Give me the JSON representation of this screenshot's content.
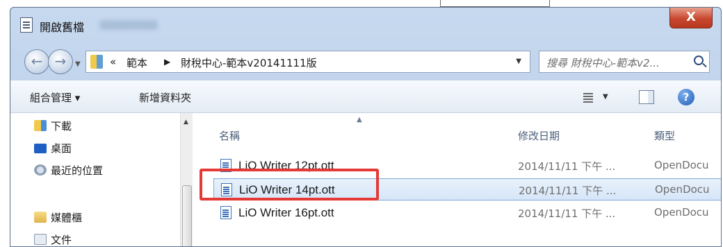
{
  "window": {
    "title": "開啟舊檔",
    "close_label": "X"
  },
  "address": {
    "prefix": "«",
    "crumbs": [
      "範本",
      "財稅中心-範本v20141111版"
    ],
    "separator": "▶",
    "search_placeholder": "搜尋 財稅中心-範本v2..."
  },
  "toolbar": {
    "organize_label": "組合管理 ▾",
    "new_folder_label": "新增資料夾",
    "help_label": "?"
  },
  "sidebar": {
    "items": [
      {
        "label": "下載",
        "icon": "download-folder-icon"
      },
      {
        "label": "桌面",
        "icon": "desktop-icon"
      },
      {
        "label": "最近的位置",
        "icon": "recent-places-icon"
      },
      {
        "label": "媒體櫃",
        "icon": "library-icon"
      },
      {
        "label": "文件",
        "icon": "documents-icon"
      }
    ]
  },
  "filelist": {
    "columns": [
      "名稱",
      "修改日期",
      "類型"
    ],
    "rows": [
      {
        "name": "LiO Writer 12pt.ott",
        "date": "2014/11/11 下午 ...",
        "type": "OpenDocu"
      },
      {
        "name": "LiO Writer 14pt.ott",
        "date": "2014/11/11 下午 ...",
        "type": "OpenDocu",
        "selected": true
      },
      {
        "name": "LiO Writer 16pt.ott",
        "date": "2014/11/11 下午 ...",
        "type": "OpenDocu"
      }
    ]
  },
  "colors": {
    "highlight": "#e53935",
    "selection": "#d6e6f8",
    "close_button": "#c8472e"
  }
}
